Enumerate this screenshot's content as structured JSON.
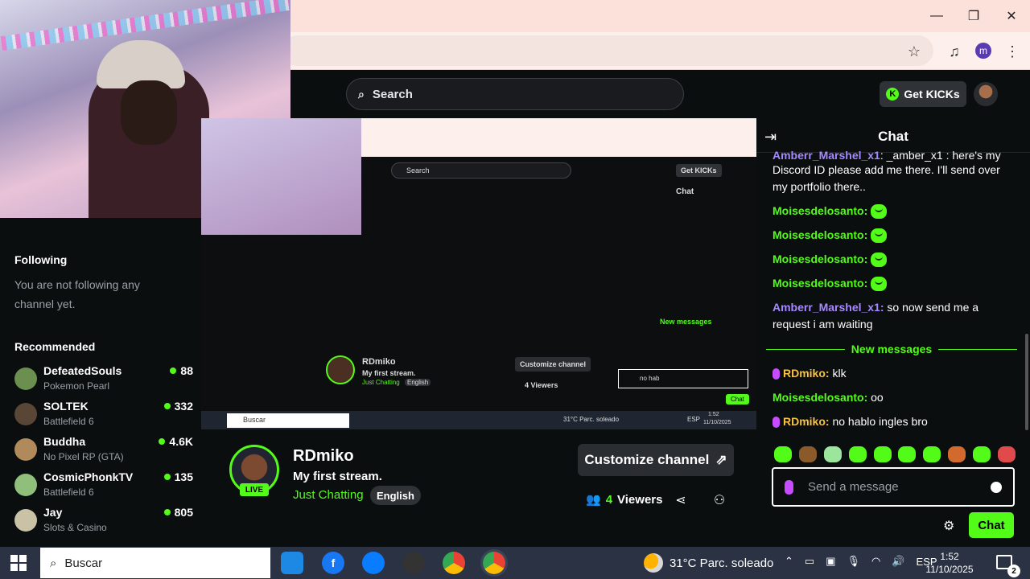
{
  "window": {
    "minimize": "—",
    "maximize": "❐",
    "close": "✕"
  },
  "browser": {
    "profile_initial": "m"
  },
  "kick": {
    "search_placeholder": "Search",
    "get_kicks": "Get KICKs",
    "kick_coin_glyph": "K"
  },
  "sidebar": {
    "following_heading": "Following",
    "following_note": "You are not following any channel yet.",
    "recommended_heading": "Recommended",
    "channels": [
      {
        "name": "DefeatedSouls",
        "game": "Pokemon Pearl",
        "viewers": "88",
        "color": "#6b8f4e"
      },
      {
        "name": "SOLTEK",
        "game": "Battlefield 6",
        "viewers": "332",
        "color": "#5a4636"
      },
      {
        "name": "Buddha",
        "game": "No Pixel RP (GTA)",
        "viewers": "4.6K",
        "color": "#b08a5a"
      },
      {
        "name": "CosmicPhonkTV",
        "game": "Battlefield 6",
        "viewers": "135",
        "color": "#8fbf7a"
      },
      {
        "name": "Jay",
        "game": "Slots & Casino",
        "viewers": "805",
        "color": "#c9c2a6"
      }
    ]
  },
  "nested": {
    "search": "Search",
    "get_kicks": "Get KICKs",
    "chat_title": "Chat",
    "channel": "RDmiko",
    "title": "My first stream.",
    "category": "Just Chatting",
    "lang": "English",
    "customize": "Customize channel",
    "viewers": "4 Viewers",
    "new_messages": "New messages",
    "input_text": "no hab",
    "chat_btn": "Chat",
    "taskbar_search": "Buscar",
    "weather": "31°C Parc. soleado",
    "lang_code": "ESP",
    "time": "1:52",
    "date": "11/10/2025"
  },
  "stream": {
    "live_badge": "LIVE",
    "channel_name": "RDmiko",
    "title": "My first stream.",
    "category": "Just Chatting",
    "language": "English",
    "customize_label": "Customize channel",
    "viewer_count": "4",
    "viewers_label": "Viewers"
  },
  "chat": {
    "title": "Chat",
    "messages": [
      {
        "user": "",
        "text": "Discord ID please add me there. I'll send over my portfolio there.."
      },
      {
        "user": "Moisesdelosanto:",
        "text": ""
      },
      {
        "user": "Moisesdelosanto:",
        "text": ""
      },
      {
        "user": "Moisesdelosanto:",
        "text": ""
      },
      {
        "user": "Moisesdelosanto:",
        "text": ""
      },
      {
        "user": "Amberr_Marshel_x1:",
        "text": " so now send me a request i am waiting"
      }
    ],
    "partial_top_user": "Amberr_Marshel_x1",
    "partial_top_text": ": _amber_x1 : here's my",
    "new_messages": "New messages",
    "new": [
      {
        "user": "RDmiko:",
        "text": " klk"
      },
      {
        "user": "Moisesdelosanto:",
        "text": " oo"
      },
      {
        "user": "RDmiko:",
        "text": " no hablo ingles bro"
      }
    ],
    "input_placeholder": "Send a message",
    "send_label": "Chat"
  },
  "taskbar": {
    "search_placeholder": "Buscar",
    "weather": "31°C  Parc. soleado",
    "language": "ESP",
    "time": "1:52",
    "date": "11/10/2025",
    "notification_count": "2"
  },
  "colors": {
    "accent": "#53fc18",
    "background": "#0b0e0f",
    "chrome": "#fbe1da"
  }
}
